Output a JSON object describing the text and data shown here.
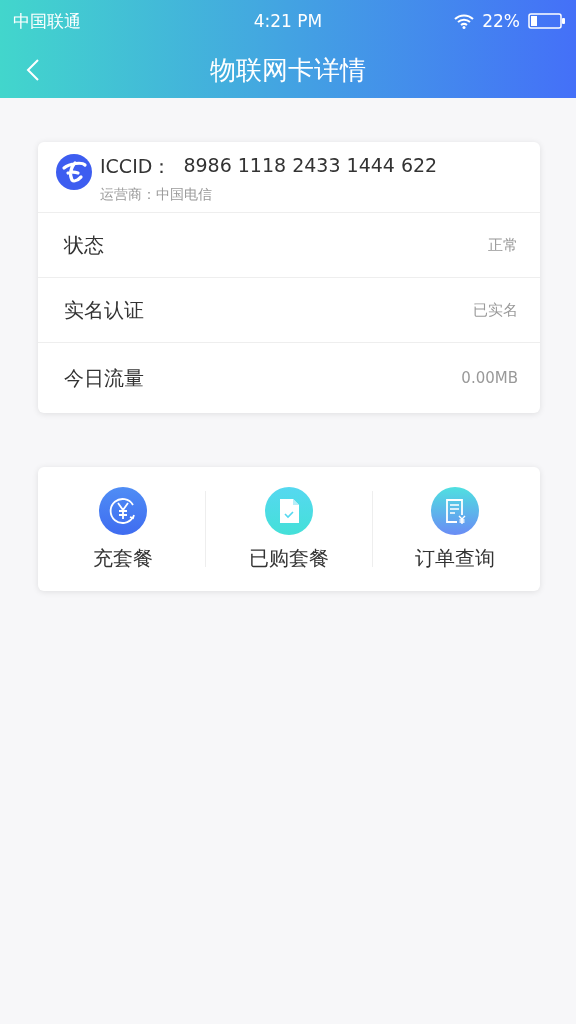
{
  "status_bar": {
    "carrier": "中国联通",
    "time": "4:21 PM",
    "battery": "22%"
  },
  "nav": {
    "title": "物联网卡详情"
  },
  "card": {
    "iccid_label": "ICCID：",
    "iccid": "8986 1118 2433 1444 622",
    "operator": "运营商：中国电信",
    "rows": [
      {
        "label": "状态",
        "value": "正常"
      },
      {
        "label": "实名认证",
        "value": "已实名"
      },
      {
        "label": "今日流量",
        "value": "0.00MB"
      }
    ]
  },
  "actions": [
    {
      "kind": "recharge",
      "label": "充套餐"
    },
    {
      "kind": "purchased",
      "label": "已购套餐"
    },
    {
      "kind": "orders",
      "label": "订单查询"
    }
  ]
}
